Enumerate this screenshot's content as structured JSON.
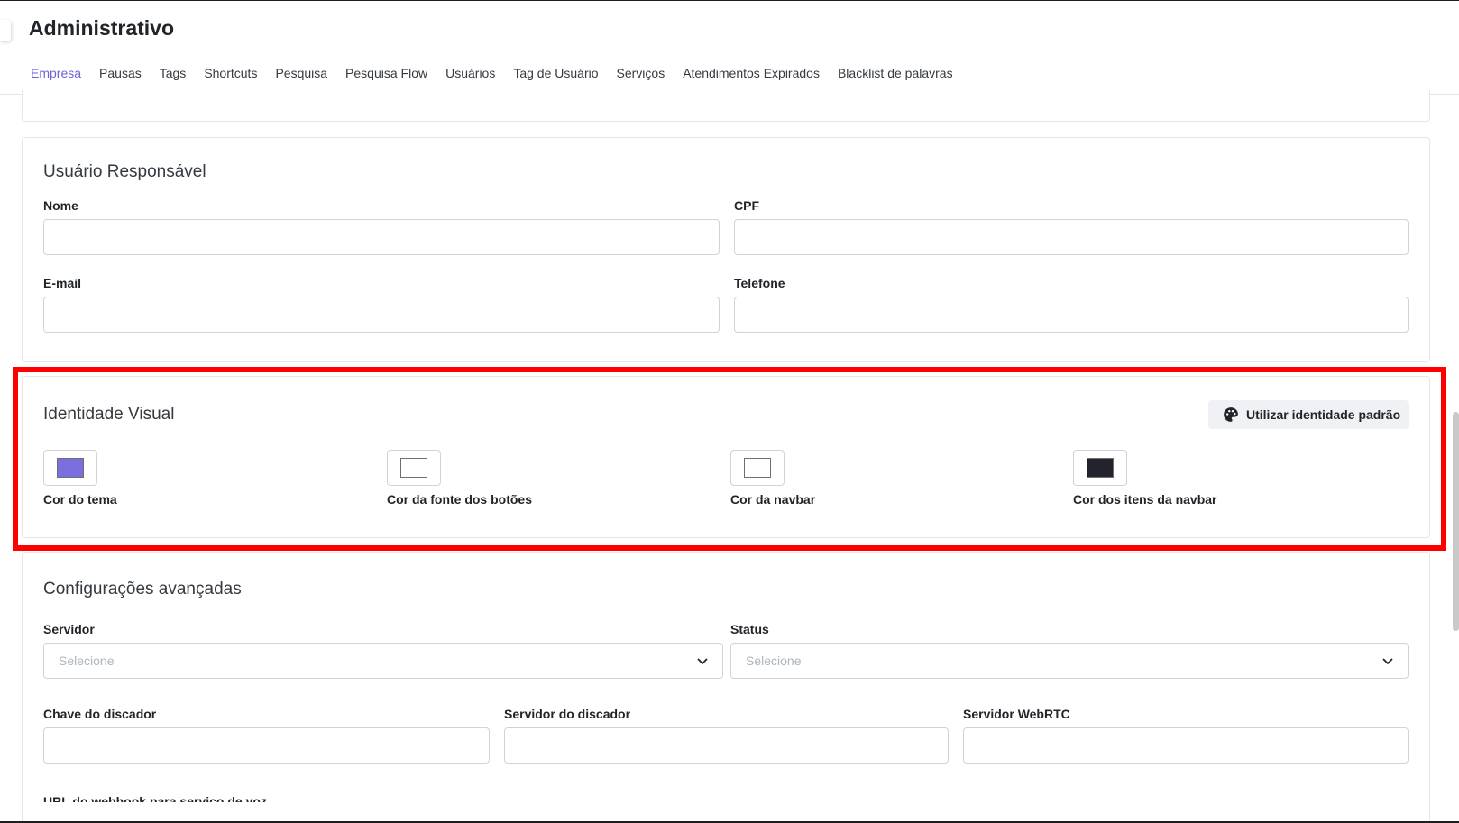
{
  "header": {
    "title": "Administrativo",
    "back_icon": "chevron-left-icon"
  },
  "tabs": [
    {
      "label": "Empresa",
      "active": true
    },
    {
      "label": "Pausas"
    },
    {
      "label": "Tags"
    },
    {
      "label": "Shortcuts"
    },
    {
      "label": "Pesquisa"
    },
    {
      "label": "Pesquisa Flow"
    },
    {
      "label": "Usuários"
    },
    {
      "label": "Tag de Usuário"
    },
    {
      "label": "Serviços"
    },
    {
      "label": "Atendimentos Expirados"
    },
    {
      "label": "Blacklist de palavras"
    }
  ],
  "responsible_user": {
    "title": "Usuário Responsável",
    "name_label": "Nome",
    "cpf_label": "CPF",
    "email_label": "E-mail",
    "phone_label": "Telefone"
  },
  "visual_identity": {
    "title": "Identidade Visual",
    "default_button_label": "Utilizar identidade padrão",
    "default_button_icon": "palette-icon",
    "colors": [
      {
        "label": "Cor do tema",
        "color": "#7b6fe0"
      },
      {
        "label": "Cor da fonte dos botões",
        "color": "#ffffff"
      },
      {
        "label": "Cor da navbar",
        "color": "#ffffff"
      },
      {
        "label": "Cor dos itens da navbar",
        "color": "#23232e"
      }
    ]
  },
  "advanced": {
    "title": "Configurações avançadas",
    "server_label": "Servidor",
    "server_placeholder": "Selecione",
    "status_label": "Status",
    "status_placeholder": "Selecione",
    "dialer_key_label": "Chave do discador",
    "dialer_server_label": "Servidor do discador",
    "webrtc_label": "Servidor WebRTC",
    "webhook_label": "URL do webhook para serviço de voz"
  },
  "colors": {
    "accent": "#6c63d9",
    "highlight": "#ff0000"
  }
}
